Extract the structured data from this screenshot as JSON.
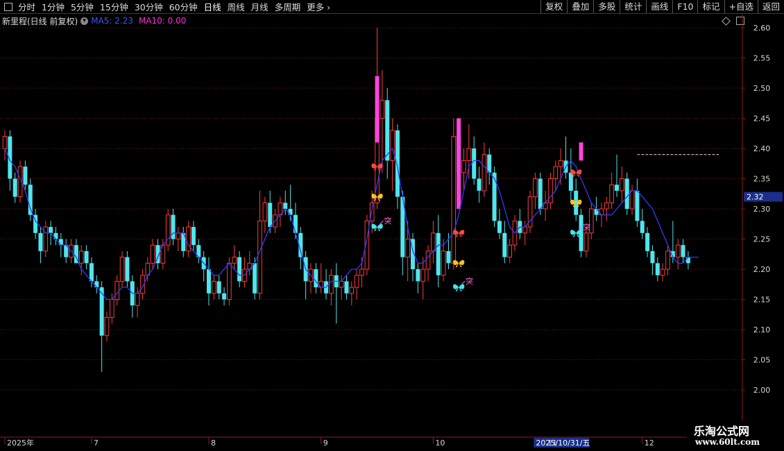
{
  "toolbar": {
    "periods": [
      "分时",
      "1分钟",
      "5分钟",
      "15分钟",
      "30分钟",
      "60分钟",
      "日线",
      "周线",
      "月线",
      "多周期",
      "更多"
    ],
    "active": "日线",
    "right_buttons": [
      "复权",
      "叠加",
      "多股",
      "统计",
      "画线",
      "F10",
      "标记",
      "+自选",
      "返回"
    ]
  },
  "info": {
    "symbol": "新里程(日线 前复权)",
    "ma5": "MA5: 2.23",
    "ma10": "MA10: 0.00"
  },
  "colors": {
    "up": "#ff3c3c",
    "down": "#4ee6ee",
    "ma5": "#2d3cff",
    "grid": "#7a1e1e",
    "price_tag_bg": "#1a2f8a",
    "signal_bar": "#ff44dd"
  },
  "chart_data": {
    "type": "candlestick",
    "y_ticks": [
      "2.60",
      "2.55",
      "2.50",
      "2.45",
      "2.40",
      "2.35",
      "2.30",
      "2.25",
      "2.20",
      "2.15",
      "2.10",
      "2.05",
      "2.00"
    ],
    "ylim": [
      1.95,
      2.62
    ],
    "current_price": "2.32",
    "x_labels": [
      {
        "label": "2025年",
        "index": 0
      },
      {
        "label": "7",
        "index": 17
      },
      {
        "label": "8",
        "index": 40
      },
      {
        "label": "9",
        "index": 62
      },
      {
        "label": "10",
        "index": 84
      },
      {
        "label": "2025/10/31/五",
        "index": 104
      },
      {
        "label": "11",
        "index": 106
      },
      {
        "label": "12",
        "index": 125
      }
    ],
    "highlight_label": "2025/10/31/五",
    "ma5": [
      2.4,
      2.38,
      2.37,
      2.35,
      2.33,
      2.3,
      2.28,
      2.27,
      2.26,
      2.26,
      2.25,
      2.24,
      2.24,
      2.23,
      2.22,
      2.2,
      2.19,
      2.18,
      2.17,
      2.16,
      2.15,
      2.15,
      2.16,
      2.17,
      2.17,
      2.16,
      2.16,
      2.17,
      2.19,
      2.2,
      2.22,
      2.24,
      2.25,
      2.26,
      2.26,
      2.26,
      2.24,
      2.23,
      2.22,
      2.21,
      2.2,
      2.19,
      2.19,
      2.2,
      2.21,
      2.2,
      2.19,
      2.19,
      2.2,
      2.21,
      2.23,
      2.25,
      2.27,
      2.28,
      2.29,
      2.3,
      2.29,
      2.26,
      2.23,
      2.2,
      2.19,
      2.18,
      2.17,
      2.17,
      2.18,
      2.18,
      2.18,
      2.19,
      2.2,
      2.2,
      2.21,
      2.25,
      2.3,
      2.34,
      2.38,
      2.39,
      2.4,
      2.37,
      2.32,
      2.27,
      2.23,
      2.21,
      2.21,
      2.22,
      2.23,
      2.24,
      2.24,
      2.25,
      2.26,
      2.29,
      2.33,
      2.37,
      2.38,
      2.38,
      2.37,
      2.36,
      2.35,
      2.33,
      2.3,
      2.27,
      2.26,
      2.27,
      2.27,
      2.28,
      2.29,
      2.3,
      2.31,
      2.32,
      2.33,
      2.35,
      2.37,
      2.38,
      2.37,
      2.35,
      2.33,
      2.31,
      2.3,
      2.29,
      2.29,
      2.29,
      2.3,
      2.31,
      2.32,
      2.33,
      2.33,
      2.32,
      2.31,
      2.3,
      2.28,
      2.26,
      2.24,
      2.22,
      2.21,
      2.21,
      2.22,
      2.22,
      2.22
    ],
    "ohlc": [
      [
        2.4,
        2.43,
        2.38,
        2.42
      ],
      [
        2.42,
        2.43,
        2.33,
        2.35
      ],
      [
        2.35,
        2.36,
        2.31,
        2.32
      ],
      [
        2.32,
        2.38,
        2.31,
        2.37
      ],
      [
        2.37,
        2.38,
        2.33,
        2.34
      ],
      [
        2.34,
        2.35,
        2.28,
        2.29
      ],
      [
        2.29,
        2.3,
        2.25,
        2.26
      ],
      [
        2.26,
        2.27,
        2.21,
        2.23
      ],
      [
        2.23,
        2.28,
        2.22,
        2.27
      ],
      [
        2.27,
        2.28,
        2.24,
        2.26
      ],
      [
        2.26,
        2.27,
        2.24,
        2.25
      ],
      [
        2.25,
        2.26,
        2.22,
        2.24
      ],
      [
        2.24,
        2.25,
        2.21,
        2.22
      ],
      [
        2.22,
        2.25,
        2.21,
        2.24
      ],
      [
        2.24,
        2.25,
        2.21,
        2.21
      ],
      [
        2.21,
        2.24,
        2.19,
        2.23
      ],
      [
        2.23,
        2.24,
        2.2,
        2.21
      ],
      [
        2.21,
        2.22,
        2.17,
        2.18
      ],
      [
        2.18,
        2.19,
        2.16,
        2.17
      ],
      [
        2.17,
        2.18,
        2.03,
        2.09
      ],
      [
        2.09,
        2.13,
        2.08,
        2.12
      ],
      [
        2.12,
        2.16,
        2.11,
        2.15
      ],
      [
        2.15,
        2.19,
        2.14,
        2.18
      ],
      [
        2.18,
        2.23,
        2.17,
        2.22
      ],
      [
        2.22,
        2.23,
        2.17,
        2.18
      ],
      [
        2.18,
        2.19,
        2.12,
        2.14
      ],
      [
        2.14,
        2.17,
        2.12,
        2.16
      ],
      [
        2.16,
        2.2,
        2.15,
        2.19
      ],
      [
        2.19,
        2.22,
        2.18,
        2.21
      ],
      [
        2.21,
        2.25,
        2.2,
        2.24
      ],
      [
        2.24,
        2.25,
        2.2,
        2.21
      ],
      [
        2.21,
        2.25,
        2.2,
        2.24
      ],
      [
        2.24,
        2.3,
        2.23,
        2.29
      ],
      [
        2.29,
        2.3,
        2.24,
        2.25
      ],
      [
        2.25,
        2.27,
        2.23,
        2.26
      ],
      [
        2.26,
        2.27,
        2.22,
        2.23
      ],
      [
        2.23,
        2.28,
        2.22,
        2.27
      ],
      [
        2.27,
        2.28,
        2.23,
        2.24
      ],
      [
        2.24,
        2.25,
        2.21,
        2.22
      ],
      [
        2.22,
        2.23,
        2.18,
        2.2
      ],
      [
        2.2,
        2.22,
        2.14,
        2.16
      ],
      [
        2.16,
        2.19,
        2.15,
        2.18
      ],
      [
        2.18,
        2.19,
        2.15,
        2.16
      ],
      [
        2.16,
        2.17,
        2.14,
        2.15
      ],
      [
        2.15,
        2.22,
        2.14,
        2.21
      ],
      [
        2.21,
        2.24,
        2.2,
        2.22
      ],
      [
        2.22,
        2.23,
        2.17,
        2.18
      ],
      [
        2.18,
        2.22,
        2.17,
        2.2
      ],
      [
        2.2,
        2.23,
        2.19,
        2.21
      ],
      [
        2.21,
        2.22,
        2.15,
        2.16
      ],
      [
        2.16,
        2.33,
        2.15,
        2.28
      ],
      [
        2.28,
        2.32,
        2.26,
        2.31
      ],
      [
        2.31,
        2.33,
        2.26,
        2.27
      ],
      [
        2.27,
        2.3,
        2.26,
        2.29
      ],
      [
        2.29,
        2.32,
        2.27,
        2.31
      ],
      [
        2.31,
        2.33,
        2.29,
        2.3
      ],
      [
        2.3,
        2.34,
        2.28,
        2.29
      ],
      [
        2.29,
        2.31,
        2.25,
        2.26
      ],
      [
        2.26,
        2.27,
        2.2,
        2.22
      ],
      [
        2.22,
        2.23,
        2.15,
        2.18
      ],
      [
        2.18,
        2.21,
        2.16,
        2.2
      ],
      [
        2.2,
        2.21,
        2.16,
        2.17
      ],
      [
        2.17,
        2.21,
        2.16,
        2.18
      ],
      [
        2.18,
        2.2,
        2.15,
        2.16
      ],
      [
        2.16,
        2.2,
        2.14,
        2.19
      ],
      [
        2.19,
        2.21,
        2.11,
        2.17
      ],
      [
        2.17,
        2.19,
        2.15,
        2.18
      ],
      [
        2.18,
        2.19,
        2.15,
        2.16
      ],
      [
        2.16,
        2.18,
        2.14,
        2.17
      ],
      [
        2.17,
        2.2,
        2.15,
        2.19
      ],
      [
        2.19,
        2.22,
        2.17,
        2.2
      ],
      [
        2.2,
        2.29,
        2.19,
        2.28
      ],
      [
        2.28,
        2.33,
        2.26,
        2.31
      ],
      [
        2.31,
        2.6,
        2.3,
        2.45
      ],
      [
        2.45,
        2.53,
        2.36,
        2.48
      ],
      [
        2.48,
        2.5,
        2.35,
        2.38
      ],
      [
        2.38,
        2.45,
        2.33,
        2.43
      ],
      [
        2.43,
        2.44,
        2.3,
        2.32
      ],
      [
        2.32,
        2.33,
        2.19,
        2.22
      ],
      [
        2.22,
        2.28,
        2.18,
        2.25
      ],
      [
        2.25,
        2.26,
        2.18,
        2.2
      ],
      [
        2.2,
        2.21,
        2.16,
        2.18
      ],
      [
        2.18,
        2.22,
        2.15,
        2.2
      ],
      [
        2.2,
        2.24,
        2.18,
        2.23
      ],
      [
        2.23,
        2.28,
        2.21,
        2.26
      ],
      [
        2.26,
        2.29,
        2.17,
        2.19
      ],
      [
        2.19,
        2.25,
        2.18,
        2.23
      ],
      [
        2.23,
        2.26,
        2.2,
        2.21
      ],
      [
        2.21,
        2.45,
        2.2,
        2.42
      ],
      [
        2.42,
        2.44,
        2.32,
        2.36
      ],
      [
        2.36,
        2.4,
        2.33,
        2.38
      ],
      [
        2.38,
        2.44,
        2.35,
        2.4
      ],
      [
        2.4,
        2.42,
        2.34,
        2.35
      ],
      [
        2.35,
        2.37,
        2.31,
        2.33
      ],
      [
        2.33,
        2.41,
        2.32,
        2.39
      ],
      [
        2.39,
        2.4,
        2.34,
        2.36
      ],
      [
        2.36,
        2.37,
        2.27,
        2.28
      ],
      [
        2.28,
        2.3,
        2.25,
        2.26
      ],
      [
        2.26,
        2.28,
        2.21,
        2.22
      ],
      [
        2.22,
        2.25,
        2.21,
        2.24
      ],
      [
        2.24,
        2.29,
        2.23,
        2.28
      ],
      [
        2.28,
        2.3,
        2.25,
        2.26
      ],
      [
        2.26,
        2.28,
        2.24,
        2.27
      ],
      [
        2.27,
        2.33,
        2.26,
        2.32
      ],
      [
        2.32,
        2.36,
        2.3,
        2.35
      ],
      [
        2.35,
        2.36,
        2.29,
        2.3
      ],
      [
        2.3,
        2.33,
        2.28,
        2.31
      ],
      [
        2.31,
        2.36,
        2.3,
        2.35
      ],
      [
        2.35,
        2.38,
        2.33,
        2.37
      ],
      [
        2.37,
        2.4,
        2.34,
        2.38
      ],
      [
        2.38,
        2.42,
        2.35,
        2.36
      ],
      [
        2.36,
        2.4,
        2.31,
        2.33
      ],
      [
        2.33,
        2.35,
        2.28,
        2.29
      ],
      [
        2.29,
        2.3,
        2.22,
        2.23
      ],
      [
        2.23,
        2.27,
        2.22,
        2.26
      ],
      [
        2.26,
        2.31,
        2.25,
        2.3
      ],
      [
        2.3,
        2.32,
        2.28,
        2.29
      ],
      [
        2.29,
        2.31,
        2.27,
        2.3
      ],
      [
        2.3,
        2.32,
        2.28,
        2.31
      ],
      [
        2.31,
        2.36,
        2.3,
        2.34
      ],
      [
        2.34,
        2.39,
        2.32,
        2.33
      ],
      [
        2.33,
        2.37,
        2.31,
        2.35
      ],
      [
        2.35,
        2.36,
        2.29,
        2.3
      ],
      [
        2.3,
        2.34,
        2.29,
        2.33
      ],
      [
        2.33,
        2.35,
        2.27,
        2.28
      ],
      [
        2.28,
        2.3,
        2.25,
        2.26
      ],
      [
        2.26,
        2.27,
        2.22,
        2.23
      ],
      [
        2.23,
        2.24,
        2.19,
        2.21
      ],
      [
        2.21,
        2.22,
        2.18,
        2.19
      ],
      [
        2.19,
        2.21,
        2.18,
        2.2
      ],
      [
        2.2,
        2.24,
        2.19,
        2.23
      ],
      [
        2.23,
        2.28,
        2.21,
        2.22
      ],
      [
        2.22,
        2.25,
        2.2,
        2.24
      ],
      [
        2.24,
        2.25,
        2.21,
        2.22
      ],
      [
        2.22,
        2.23,
        2.2,
        2.21
      ]
    ],
    "signal_bars": [
      {
        "index": 73,
        "from": 2.41,
        "to": 2.52
      },
      {
        "index": 89,
        "from": 2.3,
        "to": 2.45
      },
      {
        "index": 113,
        "from": 2.38,
        "to": 2.41
      }
    ],
    "resistance": {
      "from_index": 124,
      "to_index": 140,
      "value": 2.39
    },
    "markers": [
      {
        "index": 73,
        "value": 2.37,
        "color": "#ff4a3a"
      },
      {
        "index": 73,
        "value": 2.32,
        "color": "#ffc21a"
      },
      {
        "index": 73,
        "value": 2.27,
        "color": "#3ee8f0",
        "label": "突"
      },
      {
        "index": 89,
        "value": 2.26,
        "color": "#ff4a3a"
      },
      {
        "index": 89,
        "value": 2.21,
        "color": "#ffc21a"
      },
      {
        "index": 89,
        "value": 2.17,
        "color": "#3ee8f0",
        "label": "突"
      },
      {
        "index": 112,
        "value": 2.36,
        "color": "#ff4a3a"
      },
      {
        "index": 112,
        "value": 2.31,
        "color": "#ffc21a"
      },
      {
        "index": 112,
        "value": 2.26,
        "color": "#3ee8f0",
        "label": "突"
      }
    ]
  },
  "watermark": {
    "title": "乐淘公式网",
    "url": "www.60lt.com"
  }
}
